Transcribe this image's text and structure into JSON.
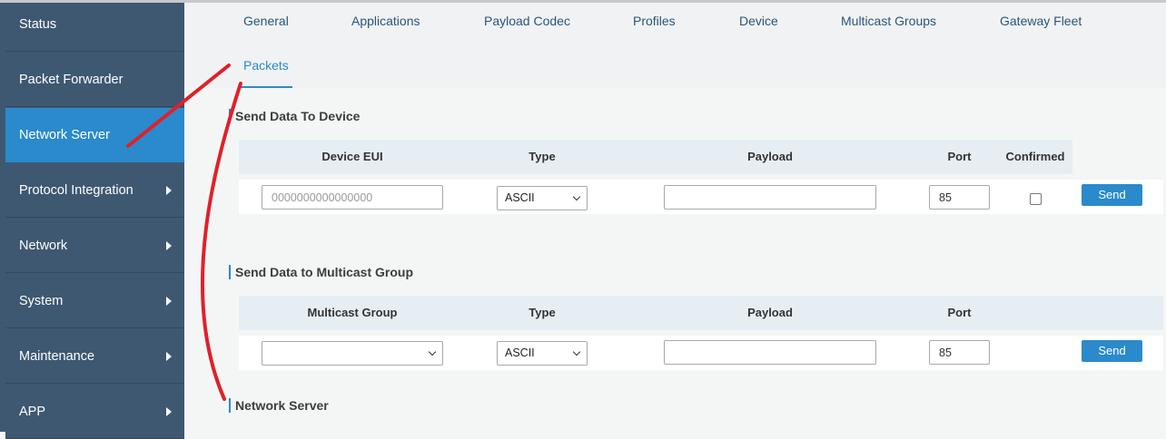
{
  "sidebar": {
    "items": [
      {
        "label": "Status",
        "active": false,
        "has_arrow": false
      },
      {
        "label": "Packet Forwarder",
        "active": false,
        "has_arrow": false
      },
      {
        "label": "Network Server",
        "active": true,
        "has_arrow": false
      },
      {
        "label": "Protocol Integration",
        "active": false,
        "has_arrow": true
      },
      {
        "label": "Network",
        "active": false,
        "has_arrow": true
      },
      {
        "label": "System",
        "active": false,
        "has_arrow": true
      },
      {
        "label": "Maintenance",
        "active": false,
        "has_arrow": true
      },
      {
        "label": "APP",
        "active": false,
        "has_arrow": true
      }
    ]
  },
  "tabs": {
    "general": "General",
    "applications": "Applications",
    "payload_codec": "Payload Codec",
    "profiles": "Profiles",
    "device": "Device",
    "multicast_groups": "Multicast Groups",
    "gateway_fleet": "Gateway Fleet",
    "packets": "Packets"
  },
  "send_device": {
    "title": "Send Data To Device",
    "headers": {
      "device_eui": "Device EUI",
      "type": "Type",
      "payload": "Payload",
      "port": "Port",
      "confirmed": "Confirmed"
    },
    "device_eui_placeholder": "0000000000000000",
    "type_value": "ASCII",
    "payload_value": "",
    "port_value": "85",
    "confirmed": false,
    "send_label": "Send"
  },
  "send_multicast": {
    "title": "Send Data to Multicast Group",
    "headers": {
      "multicast_group": "Multicast Group",
      "type": "Type",
      "payload": "Payload",
      "port": "Port"
    },
    "multicast_group_value": "",
    "type_value": "ASCII",
    "payload_value": "",
    "port_value": "85",
    "send_label": "Send"
  },
  "network_server_section": {
    "title": "Network Server"
  },
  "colors": {
    "sidebar_bg": "#3e5872",
    "sidebar_active": "#2b8acb",
    "accent": "#2b8acb",
    "annotation_red": "#e0202a"
  },
  "icons": {
    "submenu_arrow": "caret-right-icon",
    "select_chevron": "chevron-down-icon"
  }
}
